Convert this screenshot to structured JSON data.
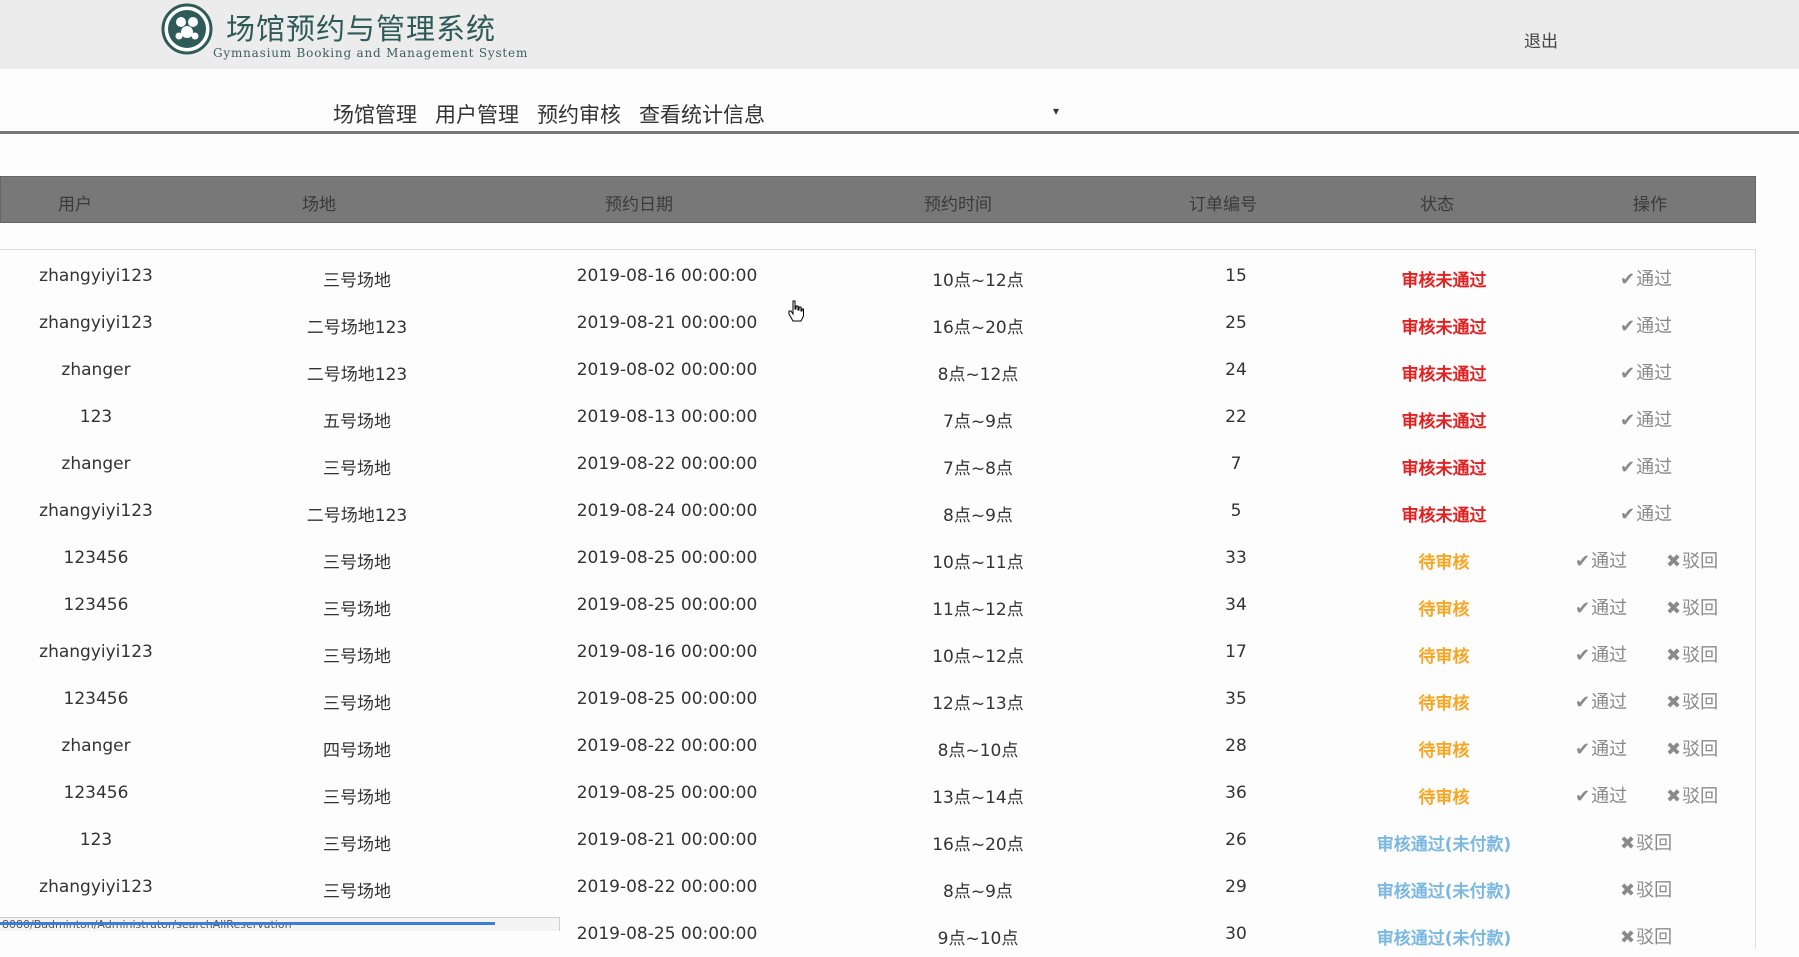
{
  "header": {
    "title": "场馆预约与管理系统",
    "subtitle": "Gymnasium Booking and Management System",
    "logout": "退出"
  },
  "nav": [
    {
      "label": "场馆管理"
    },
    {
      "label": "用户管理"
    },
    {
      "label": "预约审核"
    },
    {
      "label": "查看统计信息"
    }
  ],
  "dropdown_caret": "▾",
  "table": {
    "headers": [
      "用户",
      "场地",
      "预约日期",
      "预约时间",
      "订单编号",
      "状态",
      "操作"
    ],
    "rows": [
      {
        "user": "zhangyiyi123",
        "venue": "三号场地",
        "date": "2019-08-16 00:00:00",
        "time": "10点~12点",
        "order": "15",
        "status": "审核未通过",
        "status_type": "rejected",
        "actions": [
          "pass"
        ]
      },
      {
        "user": "zhangyiyi123",
        "venue": "二号场地123",
        "date": "2019-08-21 00:00:00",
        "time": "16点~20点",
        "order": "25",
        "status": "审核未通过",
        "status_type": "rejected",
        "actions": [
          "pass"
        ]
      },
      {
        "user": "zhanger",
        "venue": "二号场地123",
        "date": "2019-08-02 00:00:00",
        "time": "8点~12点",
        "order": "24",
        "status": "审核未通过",
        "status_type": "rejected",
        "actions": [
          "pass"
        ]
      },
      {
        "user": "123",
        "venue": "五号场地",
        "date": "2019-08-13 00:00:00",
        "time": "7点~9点",
        "order": "22",
        "status": "审核未通过",
        "status_type": "rejected",
        "actions": [
          "pass"
        ]
      },
      {
        "user": "zhanger",
        "venue": "三号场地",
        "date": "2019-08-22 00:00:00",
        "time": "7点~8点",
        "order": "7",
        "status": "审核未通过",
        "status_type": "rejected",
        "actions": [
          "pass"
        ]
      },
      {
        "user": "zhangyiyi123",
        "venue": "二号场地123",
        "date": "2019-08-24 00:00:00",
        "time": "8点~9点",
        "order": "5",
        "status": "审核未通过",
        "status_type": "rejected",
        "actions": [
          "pass"
        ]
      },
      {
        "user": "123456",
        "venue": "三号场地",
        "date": "2019-08-25 00:00:00",
        "time": "10点~11点",
        "order": "33",
        "status": "待审核",
        "status_type": "pending",
        "actions": [
          "pass",
          "reject"
        ]
      },
      {
        "user": "123456",
        "venue": "三号场地",
        "date": "2019-08-25 00:00:00",
        "time": "11点~12点",
        "order": "34",
        "status": "待审核",
        "status_type": "pending",
        "actions": [
          "pass",
          "reject"
        ]
      },
      {
        "user": "zhangyiyi123",
        "venue": "三号场地",
        "date": "2019-08-16 00:00:00",
        "time": "10点~12点",
        "order": "17",
        "status": "待审核",
        "status_type": "pending",
        "actions": [
          "pass",
          "reject"
        ]
      },
      {
        "user": "123456",
        "venue": "三号场地",
        "date": "2019-08-25 00:00:00",
        "time": "12点~13点",
        "order": "35",
        "status": "待审核",
        "status_type": "pending",
        "actions": [
          "pass",
          "reject"
        ]
      },
      {
        "user": "zhanger",
        "venue": "四号场地",
        "date": "2019-08-22 00:00:00",
        "time": "8点~10点",
        "order": "28",
        "status": "待审核",
        "status_type": "pending",
        "actions": [
          "pass",
          "reject"
        ]
      },
      {
        "user": "123456",
        "venue": "三号场地",
        "date": "2019-08-25 00:00:00",
        "time": "13点~14点",
        "order": "36",
        "status": "待审核",
        "status_type": "pending",
        "actions": [
          "pass",
          "reject"
        ]
      },
      {
        "user": "123",
        "venue": "三号场地",
        "date": "2019-08-21 00:00:00",
        "time": "16点~20点",
        "order": "26",
        "status": "审核通过(未付款)",
        "status_type": "approved",
        "actions": [
          "reject"
        ]
      },
      {
        "user": "zhangyiyi123",
        "venue": "三号场地",
        "date": "2019-08-22 00:00:00",
        "time": "8点~9点",
        "order": "29",
        "status": "审核通过(未付款)",
        "status_type": "approved",
        "actions": [
          "reject"
        ]
      },
      {
        "user": "",
        "venue": "",
        "date": "2019-08-25 00:00:00",
        "time": "9点~10点",
        "order": "30",
        "status": "审核通过(未付款)",
        "status_type": "approved",
        "actions": [
          "reject"
        ]
      }
    ],
    "action_labels": {
      "pass": "通过",
      "reject": "驳回"
    },
    "action_icons": {
      "pass": "check-icon",
      "reject": "close-icon"
    }
  },
  "colors": {
    "rejected": "#e02222",
    "pending": "#f5a623",
    "approved": "#7ab8e0",
    "header_bg": "#787878",
    "topbar_bg": "#ececec"
  },
  "statusbar": {
    "url": "8080/Badminton/Administrator/searchAllReservation"
  }
}
